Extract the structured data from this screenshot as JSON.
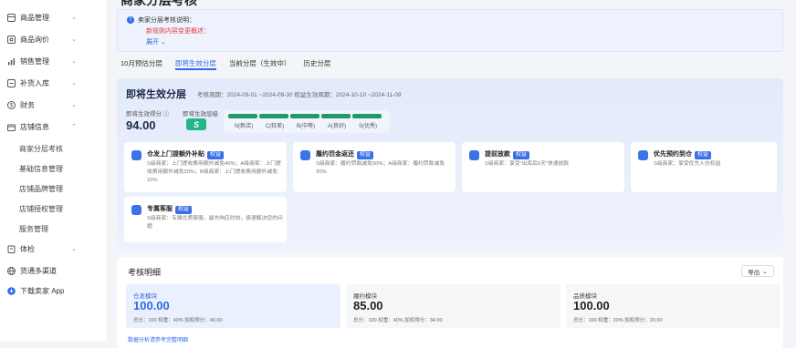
{
  "page_title": "商家分层考核",
  "sidebar": {
    "items": [
      {
        "label": "商品管理",
        "icon": "box-icon",
        "chevron": "⌄"
      },
      {
        "label": "商品询价",
        "icon": "tag-icon",
        "chevron": "⌄"
      },
      {
        "label": "销售管理",
        "icon": "chart-icon",
        "chevron": "⌄"
      },
      {
        "label": "补货入库",
        "icon": "inbox-icon",
        "chevron": "⌄"
      },
      {
        "label": "财务",
        "icon": "coin-icon",
        "chevron": "⌄"
      },
      {
        "label": "店铺信息",
        "icon": "shop-icon",
        "chevron": "⌃"
      }
    ],
    "sub_items": [
      "商家分层考核",
      "基础信息管理",
      "店铺品牌管理",
      "店铺授权管理",
      "服务管理"
    ],
    "bottom_items": [
      {
        "label": "体检",
        "icon": "clipboard-icon",
        "chevron": "⌄"
      },
      {
        "label": "货通多渠道",
        "icon": "globe-icon"
      },
      {
        "label": "下载卖家 App",
        "icon": "download-icon"
      }
    ]
  },
  "notice": {
    "icon_text": "!",
    "title": "卖家分层考核说明：",
    "change": "新规则内容变更概述：",
    "expand": "展开 ⌄"
  },
  "tabs": [
    "10月预估分层",
    "即将生效分层",
    "当前分层（生效中）",
    "历史分层"
  ],
  "active_tab": 1,
  "tier": {
    "heading": "即将生效分层",
    "meta": "考核周期：2024-09-01 ~2024-09-30   权益生效周期：2024-10-10 ~2024-11-09",
    "score_label": "即将生效得分 ⓘ",
    "score_value": "94.00",
    "grade_label": "即将生效层级",
    "grade_value": "S",
    "levels": [
      "N(新店)",
      "C(较差)",
      "B(中等)",
      "A(良好)",
      "S(优秀)"
    ]
  },
  "benefit_tag": "权益",
  "benefits": [
    {
      "title": "仓发上门提额外补贴",
      "desc": "S级商家：上门提收费用额外减免40%；A级商家：上门提收费用额外减免20%；B级商家：上门提收费用额外减免10%",
      "icon": "truck-icon"
    },
    {
      "title": "履约罚金返还",
      "desc": "S级商家：履约罚款减免50%；A级商家：履约罚款减免30%",
      "icon": "refund-icon"
    },
    {
      "title": "提前放款",
      "desc": "S级商家：享受“出库后5天”快速放款",
      "icon": "wallet-icon"
    },
    {
      "title": "优先预约到仓",
      "desc": "S级商家：享受优先入仓权益",
      "icon": "warehouse-icon"
    },
    {
      "title": "专属客服",
      "desc": "S级商家：专属优质客服，最先响应时效，极速解决您的问题",
      "icon": "headset-icon"
    }
  ],
  "detail": {
    "heading": "考核明细",
    "export_label": "导出",
    "export_chevron": "⌄",
    "modules": [
      {
        "title": "仓发模块",
        "value": "100.00",
        "meta": "总分：100   权重：40%   加权得分：40.00"
      },
      {
        "title": "履约模块",
        "value": "85.00",
        "meta": "总分：100   权重：40%   加权得分：34.00"
      },
      {
        "title": "品质模块",
        "value": "100.00",
        "meta": "总分：100   权重：20%   加权得分：20.00"
      }
    ]
  },
  "footer_link": "数据分析请参考完整明细"
}
